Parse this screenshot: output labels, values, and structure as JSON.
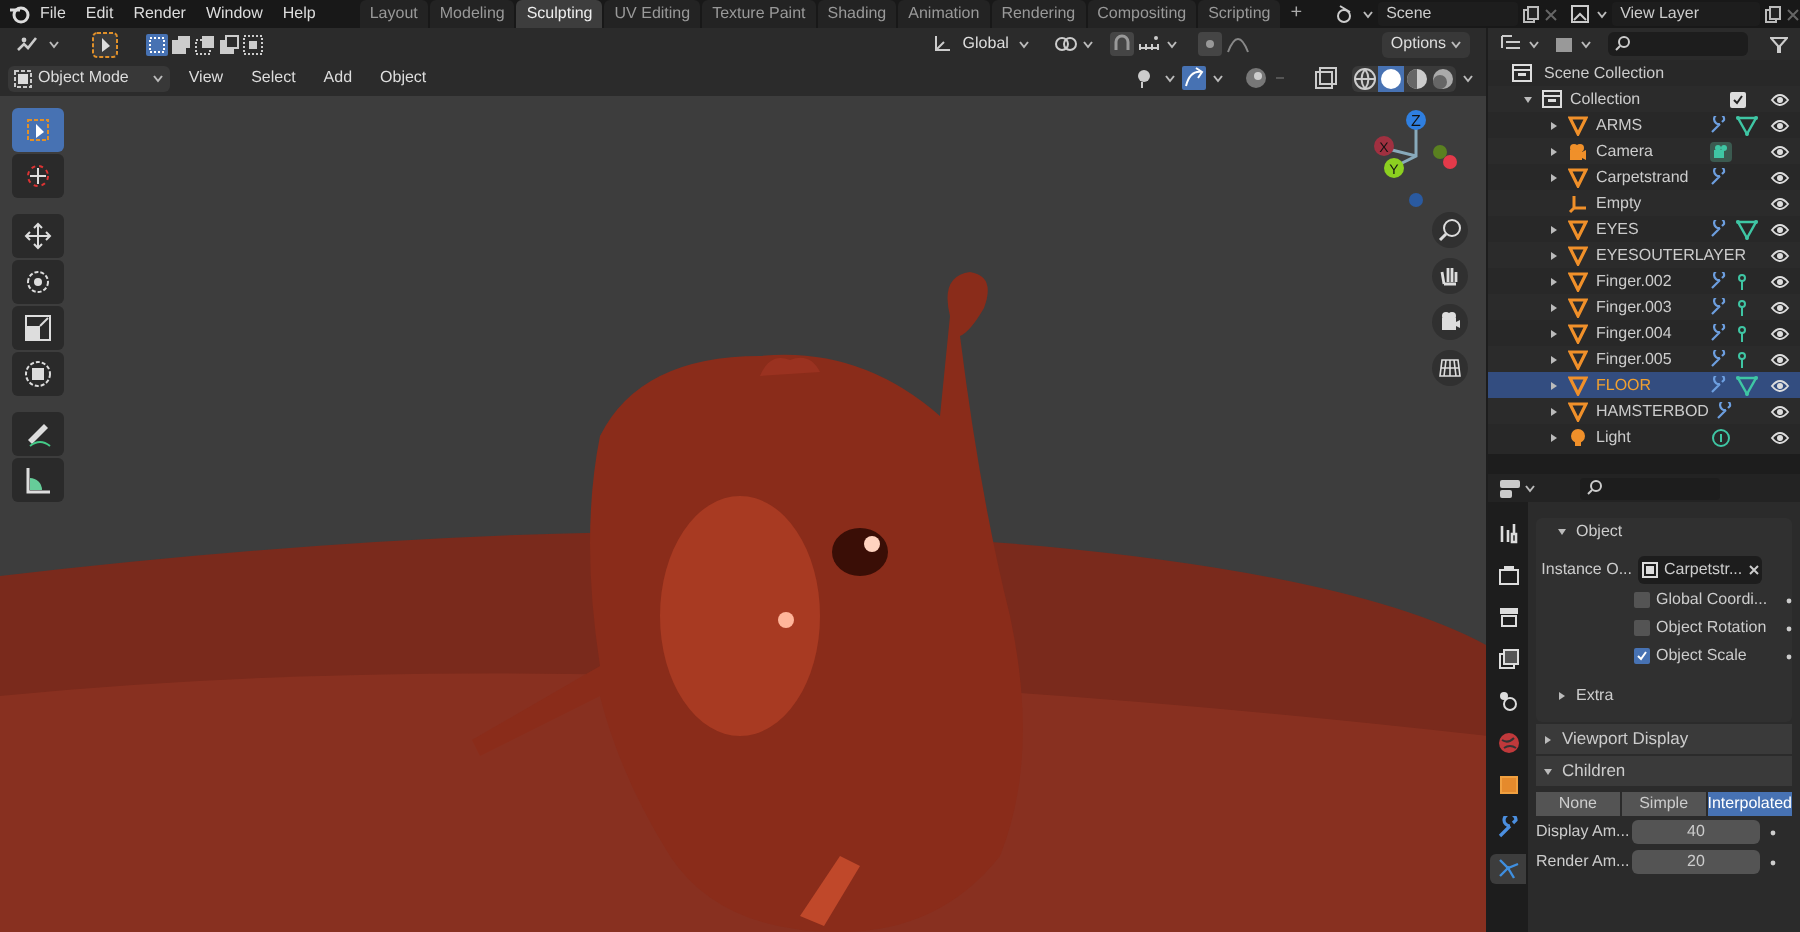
{
  "menu": [
    "File",
    "Edit",
    "Render",
    "Window",
    "Help"
  ],
  "workspace_tabs": [
    {
      "label": "Layout",
      "selected": false
    },
    {
      "label": "Modeling",
      "selected": false
    },
    {
      "label": "Sculpting",
      "selected": true
    },
    {
      "label": "UV Editing",
      "selected": false
    },
    {
      "label": "Texture Paint",
      "selected": false
    },
    {
      "label": "Shading",
      "selected": false
    },
    {
      "label": "Animation",
      "selected": false
    },
    {
      "label": "Rendering",
      "selected": false
    },
    {
      "label": "Compositing",
      "selected": false
    },
    {
      "label": "Scripting",
      "selected": false
    }
  ],
  "add_tab": "+",
  "scene": "Scene",
  "view_layer": "View Layer",
  "viewport_header": {
    "orientation": "Global",
    "options": "Options",
    "mode": "Object Mode",
    "menus": [
      "View",
      "Select",
      "Add",
      "Object"
    ]
  },
  "tools": [
    {
      "kind": "select",
      "selected": true
    },
    {
      "kind": "cursor",
      "selected": false
    },
    {
      "kind": "move",
      "selected": false
    },
    {
      "kind": "rotate",
      "selected": false
    },
    {
      "kind": "scale",
      "selected": false
    },
    {
      "kind": "transform",
      "selected": false
    },
    {
      "kind": "annotate",
      "selected": false
    },
    {
      "kind": "measure",
      "selected": false
    }
  ],
  "gizmo_axes": [
    "Z",
    "Y",
    "X"
  ],
  "outliner": {
    "root": "Scene Collection",
    "collection": {
      "name": "Collection",
      "checked": true,
      "children": [
        {
          "name": "ARMS",
          "kind": "mesh",
          "expandable": true,
          "badges": [
            {
              "kind": "modifier"
            },
            {
              "kind": "mesh"
            }
          ],
          "selected": false
        },
        {
          "name": "Camera",
          "kind": "camera",
          "expandable": true,
          "badges": [
            {
              "kind": "camera"
            }
          ],
          "selected": false
        },
        {
          "name": "Carpetstrand",
          "kind": "mesh",
          "expandable": true,
          "badges": [
            {
              "kind": "modifier"
            }
          ],
          "selected": false
        },
        {
          "name": "Empty",
          "kind": "empty",
          "expandable": false,
          "selected": false
        },
        {
          "name": "EYES",
          "kind": "mesh",
          "expandable": true,
          "badges": [
            {
              "kind": "modifier"
            },
            {
              "kind": "mesh"
            }
          ],
          "selected": false
        },
        {
          "name": "EYESOUTERLAYER",
          "kind": "mesh",
          "expandable": true,
          "selected": false
        },
        {
          "name": "Finger.002",
          "kind": "mesh",
          "expandable": true,
          "badges": [
            {
              "kind": "modifier"
            },
            {
              "kind": "hair"
            }
          ],
          "selected": false
        },
        {
          "name": "Finger.003",
          "kind": "mesh",
          "expandable": true,
          "badges": [
            {
              "kind": "modifier"
            },
            {
              "kind": "hair"
            }
          ],
          "selected": false
        },
        {
          "name": "Finger.004",
          "kind": "mesh",
          "expandable": true,
          "badges": [
            {
              "kind": "modifier"
            },
            {
              "kind": "hair"
            }
          ],
          "selected": false
        },
        {
          "name": "Finger.005",
          "kind": "mesh",
          "expandable": true,
          "badges": [
            {
              "kind": "modifier"
            },
            {
              "kind": "hair"
            }
          ],
          "selected": false
        },
        {
          "name": "FLOOR",
          "kind": "mesh",
          "expandable": true,
          "badges": [
            {
              "kind": "modifier"
            },
            {
              "kind": "mesh"
            }
          ],
          "selected": true
        },
        {
          "name": "HAMSTERBOD",
          "kind": "mesh",
          "expandable": true,
          "badges": [
            {
              "kind": "modifier"
            }
          ],
          "selected": false
        },
        {
          "name": "Light",
          "kind": "light",
          "expandable": true,
          "badges": [
            {
              "kind": "light"
            }
          ],
          "selected": false
        }
      ]
    }
  },
  "properties_tabs": [
    {
      "kind": "tool",
      "selected": false
    },
    {
      "kind": "render",
      "selected": false
    },
    {
      "kind": "output",
      "selected": false
    },
    {
      "kind": "view_layer",
      "selected": false
    },
    {
      "kind": "scene",
      "selected": false
    },
    {
      "kind": "world",
      "selected": false
    },
    {
      "kind": "object",
      "selected": false
    },
    {
      "kind": "modifier",
      "selected": false
    },
    {
      "kind": "particles",
      "selected": true
    }
  ],
  "properties": {
    "object_panel": {
      "title": "Object",
      "expanded": true,
      "instance_label": "Instance O...",
      "instance_value": "Carpetstr...",
      "checkboxes": [
        {
          "label": "Global Coordi...",
          "checked": false
        },
        {
          "label": "Object Rotation",
          "checked": false
        },
        {
          "label": "Object Scale",
          "checked": true
        }
      ]
    },
    "extra": {
      "title": "Extra",
      "expanded": false
    },
    "viewport_display": {
      "title": "Viewport Display",
      "expanded": false
    },
    "children": {
      "title": "Children",
      "expanded": true,
      "modes": [
        {
          "label": "None",
          "selected": false
        },
        {
          "label": "Simple",
          "selected": false
        },
        {
          "label": "Interpolated",
          "selected": true
        }
      ],
      "fields": [
        {
          "label": "Display Am...",
          "value": "40"
        },
        {
          "label": "Render Am...",
          "value": "20"
        }
      ]
    }
  }
}
